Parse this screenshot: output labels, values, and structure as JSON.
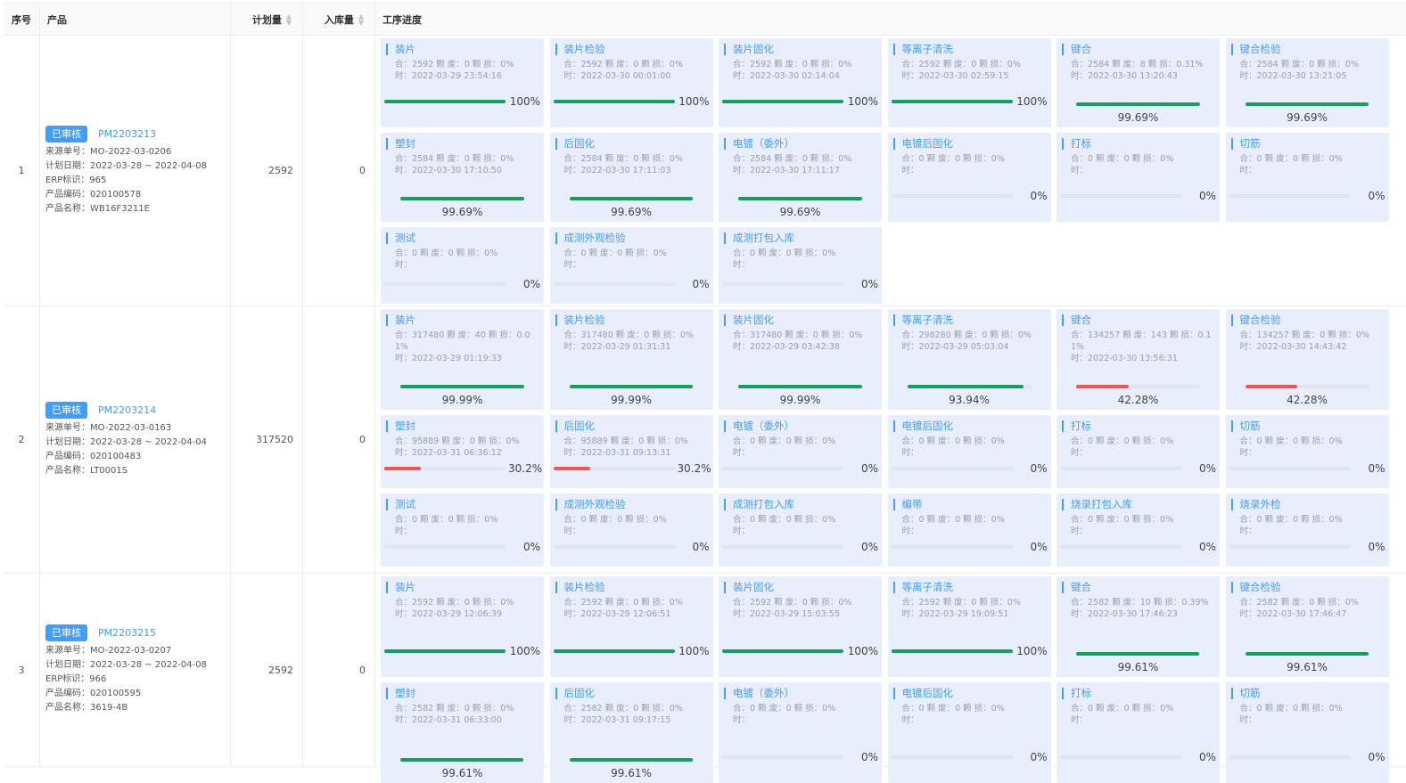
{
  "headers": {
    "no": "序号",
    "product": "产品",
    "plan": "计划量",
    "instock": "入库量",
    "process": "工序进度"
  },
  "colors": {
    "green": "#14a05a",
    "red": "#f4544c",
    "blue": "#409eff"
  },
  "rows": [
    {
      "no": "1",
      "tag": "已审核",
      "pm": "PM2203213",
      "info": [
        "来源单号：MO-2022-03-0206",
        "计划日期：2022-03-28 ~ 2022-04-08",
        "ERP标识：965",
        "产品编码：020100578",
        "产品名称：WB16F3211E"
      ],
      "plan": "2592",
      "instock": "0",
      "cards": [
        {
          "title": "装片",
          "stats": "合：2592 颗 废：0 颗 损：0%",
          "time": "时：2022-03-29 23:54:16",
          "pct": "100%",
          "value": 100,
          "status": "green"
        },
        {
          "title": "装片检验",
          "stats": "合：2592 颗 废：0 颗 损：0%",
          "time": "时：2022-03-30 00:01:00",
          "pct": "100%",
          "value": 100,
          "status": "green"
        },
        {
          "title": "装片固化",
          "stats": "合：2592 颗 废：0 颗 损：0%",
          "time": "时：2022-03-30 02:14:04",
          "pct": "100%",
          "value": 100,
          "status": "green"
        },
        {
          "title": "等离子清洗",
          "stats": "合：2592 颗 废：0 颗 损：0%",
          "time": "时：2022-03-30 02:59:15",
          "pct": "100%",
          "value": 100,
          "status": "green"
        },
        {
          "title": "键合",
          "stats": "合：2584 颗 废：8 颗 损：0.31%",
          "time": "时：2022-03-30 13:20:43",
          "pct": "99.69%",
          "value": 99.69,
          "status": "green"
        },
        {
          "title": "键合检验",
          "stats": "合：2584 颗 废：0 颗 损：0%",
          "time": "时：2022-03-30 13:21:05",
          "pct": "99.69%",
          "value": 99.69,
          "status": "green"
        },
        {
          "title": "塑封",
          "stats": "合：2584 颗 废：0 颗 损：0%",
          "time": "时：2022-03-30 17:10:50",
          "pct": "99.69%",
          "value": 99.69,
          "status": "green"
        },
        {
          "title": "后固化",
          "stats": "合：2584 颗 废：0 颗 损：0%",
          "time": "时：2022-03-30 17:11:03",
          "pct": "99.69%",
          "value": 99.69,
          "status": "green"
        },
        {
          "title": "电镀（委外）",
          "stats": "合：2584 颗 废：0 颗 损：0%",
          "time": "时：2022-03-30 17:11:17",
          "pct": "99.69%",
          "value": 99.69,
          "status": "green"
        },
        {
          "title": "电镀后固化",
          "stats": "合：0 颗 废：0 颗 损：0%",
          "time": "时：",
          "pct": "0%",
          "value": 0,
          "status": "green"
        },
        {
          "title": "打标",
          "stats": "合：0 颗 废：0 颗 损：0%",
          "time": "时：",
          "pct": "0%",
          "value": 0,
          "status": "green"
        },
        {
          "title": "切筋",
          "stats": "合：0 颗 废：0 颗 损：0%",
          "time": "时：",
          "pct": "0%",
          "value": 0,
          "status": "green"
        },
        {
          "title": "测试",
          "stats": "合：0 颗 废：0 颗 损：0%",
          "time": "时：",
          "pct": "0%",
          "value": 0,
          "status": "green"
        },
        {
          "title": "成测外观检验",
          "stats": "合：0 颗 废：0 颗 损：0%",
          "time": "时：",
          "pct": "0%",
          "value": 0,
          "status": "green"
        },
        {
          "title": "成测打包入库",
          "stats": "合：0 颗 废：0 颗 损：0%",
          "time": "时：",
          "pct": "0%",
          "value": 0,
          "status": "green"
        }
      ]
    },
    {
      "no": "2",
      "tag": "已审核",
      "pm": "PM2203214",
      "info": [
        "来源单号：MO-2022-03-0163",
        "计划日期：2022-03-28 ~ 2022-04-04",
        "产品编码：020100483",
        "产品名称：LT0001S"
      ],
      "plan": "317520",
      "instock": "0",
      "cards": [
        {
          "title": "装片",
          "stats": "合：317480 颗 废：40 颗 损：0.01%",
          "time": "时：2022-03-29 01:19:33",
          "pct": "99.99%",
          "value": 99.99,
          "status": "green"
        },
        {
          "title": "装片检验",
          "stats": "合：317480 颗 废：0 颗 损：0%",
          "time": "时：2022-03-29 01:31:31",
          "pct": "99.99%",
          "value": 99.99,
          "status": "green"
        },
        {
          "title": "装片固化",
          "stats": "合：317480 颗 废：0 颗 损：0%",
          "time": "时：2022-03-29 03:42:38",
          "pct": "99.99%",
          "value": 99.99,
          "status": "green"
        },
        {
          "title": "等离子清洗",
          "stats": "合：298280 颗 废：0 颗 损：0%",
          "time": "时：2022-03-29 05:03:04",
          "pct": "93.94%",
          "value": 93.94,
          "status": "green"
        },
        {
          "title": "键合",
          "stats": "合：134257 颗 废：143 颗 损：0.11%",
          "time": "时：2022-03-30 13:56:31",
          "pct": "42.28%",
          "value": 42.28,
          "status": "red"
        },
        {
          "title": "键合检验",
          "stats": "合：134257 颗 废：0 颗 损：0%",
          "time": "时：2022-03-30 14:43:42",
          "pct": "42.28%",
          "value": 42.28,
          "status": "red"
        },
        {
          "title": "塑封",
          "stats": "合：95889 颗 废：0 颗 损：0%",
          "time": "时：2022-03-31 06:36:12",
          "pct": "30.2%",
          "value": 30.2,
          "status": "red"
        },
        {
          "title": "后固化",
          "stats": "合：95889 颗 废：0 颗 损：0%",
          "time": "时：2022-03-31 09:13:31",
          "pct": "30.2%",
          "value": 30.2,
          "status": "red"
        },
        {
          "title": "电镀（委外）",
          "stats": "合：0 颗 废：0 颗 损：0%",
          "time": "时：",
          "pct": "0%",
          "value": 0,
          "status": "green"
        },
        {
          "title": "电镀后固化",
          "stats": "合：0 颗 废：0 颗 损：0%",
          "time": "时：",
          "pct": "0%",
          "value": 0,
          "status": "green"
        },
        {
          "title": "打标",
          "stats": "合：0 颗 废：0 颗 损：0%",
          "time": "时：",
          "pct": "0%",
          "value": 0,
          "status": "green"
        },
        {
          "title": "切筋",
          "stats": "合：0 颗 废：0 颗 损：0%",
          "time": "时：",
          "pct": "0%",
          "value": 0,
          "status": "green"
        },
        {
          "title": "测试",
          "stats": "合：0 颗 废：0 颗 损：0%",
          "time": "时：",
          "pct": "0%",
          "value": 0,
          "status": "green"
        },
        {
          "title": "成测外观检验",
          "stats": "合：0 颗 废：0 颗 损：0%",
          "time": "时：",
          "pct": "0%",
          "value": 0,
          "status": "green"
        },
        {
          "title": "成测打包入库",
          "stats": "合：0 颗 废：0 颗 损：0%",
          "time": "时：",
          "pct": "0%",
          "value": 0,
          "status": "green"
        },
        {
          "title": "编带",
          "stats": "合：0 颗 废：0 颗 损：0%",
          "time": "时：",
          "pct": "0%",
          "value": 0,
          "status": "green"
        },
        {
          "title": "烧录打包入库",
          "stats": "合：0 颗 废：0 颗 损：0%",
          "time": "时：",
          "pct": "0%",
          "value": 0,
          "status": "green"
        },
        {
          "title": "烧录外检",
          "stats": "合：0 颗 废：0 颗 损：0%",
          "time": "时：",
          "pct": "0%",
          "value": 0,
          "status": "green"
        }
      ]
    },
    {
      "no": "3",
      "tag": "已审核",
      "pm": "PM2203215",
      "info": [
        "来源单号：MO-2022-03-0207",
        "计划日期：2022-03-28 ~ 2022-04-08",
        "ERP标识：966",
        "产品编码：020100595",
        "产品名称：3619-4B"
      ],
      "plan": "2592",
      "instock": "0",
      "cards": [
        {
          "title": "装片",
          "stats": "合：2592 颗 废：0 颗 损：0%",
          "time": "时：2022-03-29 12:06:39",
          "pct": "100%",
          "value": 100,
          "status": "green"
        },
        {
          "title": "装片检验",
          "stats": "合：2592 颗 废：0 颗 损：0%",
          "time": "时：2022-03-29 12:06:51",
          "pct": "100%",
          "value": 100,
          "status": "green"
        },
        {
          "title": "装片固化",
          "stats": "合：2592 颗 废：0 颗 损：0%",
          "time": "时：2022-03-29 15:03:55",
          "pct": "100%",
          "value": 100,
          "status": "green"
        },
        {
          "title": "等离子清洗",
          "stats": "合：2592 颗 废：0 颗 损：0%",
          "time": "时：2022-03-29 19:09:51",
          "pct": "100%",
          "value": 100,
          "status": "green"
        },
        {
          "title": "键合",
          "stats": "合：2582 颗 废：10 颗 损：0.39%",
          "time": "时：2022-03-30 17:46:23",
          "pct": "99.61%",
          "value": 99.61,
          "status": "green"
        },
        {
          "title": "键合检验",
          "stats": "合：2582 颗 废：0 颗 损：0%",
          "time": "时：2022-03-30 17:46:47",
          "pct": "99.61%",
          "value": 99.61,
          "status": "green"
        },
        {
          "title": "塑封",
          "stats": "合：2582 颗 废：0 颗 损：0%",
          "time": "时：2022-03-31 06:33:00",
          "pct": "99.61%",
          "value": 99.61,
          "status": "green"
        },
        {
          "title": "后固化",
          "stats": "合：2582 颗 废：0 颗 损：0%",
          "time": "时：2022-03-31 09:17:15",
          "pct": "99.61%",
          "value": 99.61,
          "status": "green"
        },
        {
          "title": "电镀（委外）",
          "stats": "合：0 颗 废：0 颗 损：0%",
          "time": "时：",
          "pct": "0%",
          "value": 0,
          "status": "green"
        },
        {
          "title": "电镀后固化",
          "stats": "合：0 颗 废：0 颗 损：0%",
          "time": "时：",
          "pct": "0%",
          "value": 0,
          "status": "green"
        },
        {
          "title": "打标",
          "stats": "合：0 颗 废：0 颗 损：0%",
          "time": "时：",
          "pct": "0%",
          "value": 0,
          "status": "green"
        },
        {
          "title": "切筋",
          "stats": "合：0 颗 废：0 颗 损：0%",
          "time": "时：",
          "pct": "0%",
          "value": 0,
          "status": "green"
        }
      ]
    }
  ]
}
